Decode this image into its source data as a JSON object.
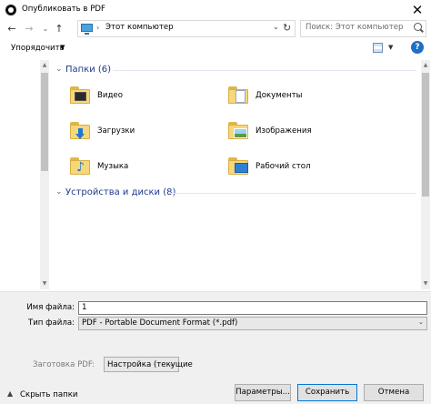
{
  "window": {
    "title": "Опубликовать в PDF",
    "close_glyph": "✕"
  },
  "nav": {
    "back": "←",
    "forward": "→",
    "recent": "⌄",
    "up": "↑"
  },
  "address": {
    "separator": "›",
    "path": "Этот компьютер",
    "dropdown": "⌄",
    "refresh": "↻"
  },
  "search": {
    "placeholder": "Поиск: Этот компьютер"
  },
  "toolbar": {
    "organize": "Упорядочить",
    "organize_arrow": "▼",
    "view_arrow": "▼",
    "help": "?"
  },
  "groups": {
    "folders": {
      "title": "Папки (6)",
      "chevron": "⌄"
    },
    "devices": {
      "title": "Устройства и диски (8)",
      "chevron": "⌄"
    }
  },
  "folders": [
    {
      "label": "Видео",
      "icon": "video-folder-icon"
    },
    {
      "label": "Документы",
      "icon": "documents-folder-icon"
    },
    {
      "label": "Загрузки",
      "icon": "downloads-folder-icon"
    },
    {
      "label": "Изображения",
      "icon": "pictures-folder-icon"
    },
    {
      "label": "Музыка",
      "icon": "music-folder-icon"
    },
    {
      "label": "Рабочий стол",
      "icon": "desktop-folder-icon"
    }
  ],
  "scroll": {
    "up": "▲",
    "down": "▼"
  },
  "form": {
    "filename_label": "Имя файла:",
    "filename_value": "1",
    "filetype_label": "Тип файла:",
    "filetype_value": "PDF - Portable Document Format (*.pdf)",
    "filetype_arrow": "⌄",
    "preset_label": "Заготовка PDF:",
    "preset_value": "Настройка (текущие",
    "preset_arrow": "⌄"
  },
  "footer": {
    "hide_toggle": "▲",
    "hide_label": "Скрыть папки",
    "params": "Параметры...",
    "save": "Сохранить",
    "cancel": "Отмена"
  }
}
